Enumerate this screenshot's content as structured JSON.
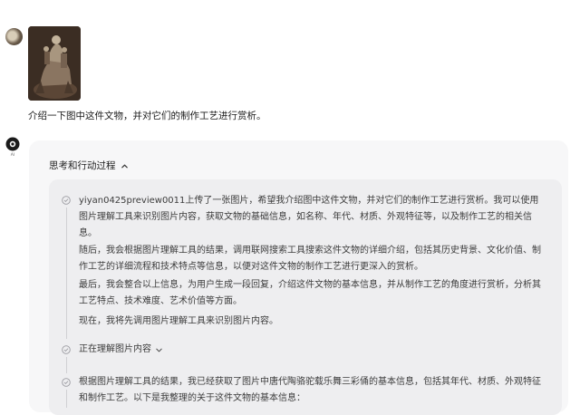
{
  "user": {
    "message": "介绍一下图中这件文物，并对它们的制作工艺进行赏析。"
  },
  "bot": {
    "avatar_label": "AI"
  },
  "thinking": {
    "header": "思考和行动过程",
    "paragraphs": [
      "yiyan0425preview0011上传了一张图片，希望我介绍图中这件文物，并对它们的制作工艺进行赏析。我可以使用图片理解工具来识别图片内容，获取文物的基础信息，如名称、年代、材质、外观特征等，以及制作工艺的相关信息。",
      "随后，我会根据图片理解工具的结果，调用联网搜索工具搜索这件文物的详细介绍，包括其历史背景、文化价值、制作工艺的详细流程和技术特点等信息，以便对这件文物的制作工艺进行更深入的赏析。",
      "最后，我会整合以上信息，为用户生成一段回复，介绍这件文物的基本信息，并从制作工艺的角度进行赏析，分析其工艺特点、技术难度、艺术价值等方面。",
      "现在，我将先调用图片理解工具来识别图片内容。"
    ],
    "step_label": "正在理解图片内容",
    "result_text": "根据图片理解工具的结果，我已经获取了图片中唐代陶骆驼载乐舞三彩俑的基本信息，包括其年代、材质、外观特征和制作工艺。以下是我整理的关于这件文物的基本信息："
  },
  "colors": {
    "card_bg": "#f7f7f8",
    "thought_bg": "#eeeef0",
    "text": "#3c3c3c"
  }
}
